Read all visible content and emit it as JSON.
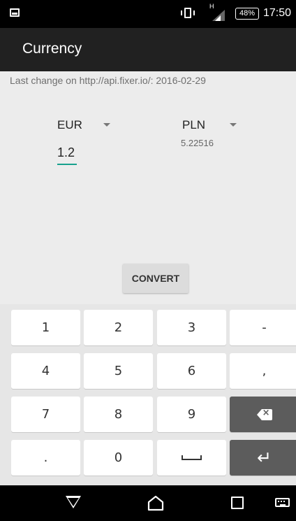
{
  "status_bar": {
    "battery_percent": "48%",
    "time": "17:50",
    "network_label": "H",
    "icons": [
      "notification-image-icon",
      "vibrate-icon",
      "signal-icon",
      "battery-icon"
    ]
  },
  "app": {
    "title": "Currency"
  },
  "last_change": "Last change on http://api.fixer.io/: 2016-02-29",
  "converter": {
    "from_currency": "EUR",
    "to_currency": "PLN",
    "amount": "1.2",
    "result": "5.22516",
    "convert_label": "CONVERT"
  },
  "keyboard": {
    "keys": [
      "1",
      "2",
      "3",
      "-",
      "4",
      "5",
      "6",
      ",",
      "7",
      "8",
      "9",
      "backspace",
      ".",
      "0",
      "space",
      "enter"
    ]
  },
  "navigation": {
    "icons": [
      "back-icon",
      "home-icon",
      "recents-icon",
      "keyboard-icon"
    ]
  },
  "colors": {
    "app_bar": "#212121",
    "accent": "#17a18d",
    "background": "#ececec"
  }
}
